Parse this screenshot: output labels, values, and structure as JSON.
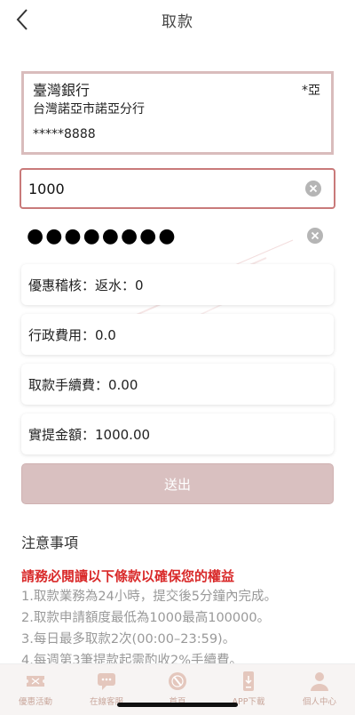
{
  "header": {
    "title": "取款"
  },
  "bank_card": {
    "bank_name": "臺灣銀行",
    "branch": "台灣諾亞市諾亞分行",
    "account_masked": "*****8888",
    "holder": "*亞"
  },
  "amount_input": {
    "value": "1000"
  },
  "password_input": {
    "value": "●●●●●●●●"
  },
  "info_rows": [
    {
      "text": "優惠稽核：返水：0"
    },
    {
      "text": "行政費用：0.0"
    },
    {
      "text": "取款手續費：0.00"
    },
    {
      "text": "實提金額：1000.00"
    }
  ],
  "submit": {
    "label": "送出"
  },
  "notes": {
    "title": "注意事項",
    "warning": "請務必閱讀以下條款以確保您的權益",
    "items": [
      "1.取款業務為24小時，提交後5分鐘內完成。",
      "2.取款申請額度最低為1000最高100000。",
      "3.每日最多取款2次(00:00–23:59)。",
      "4.每週第3筆提款起需酌收2%手續費。"
    ]
  },
  "tabbar": {
    "items": [
      {
        "label": "優惠活動",
        "icon": "ticket-icon"
      },
      {
        "label": "在線客服",
        "icon": "chat-icon"
      },
      {
        "label": "首頁",
        "icon": "home-icon"
      },
      {
        "label": "APP下載",
        "icon": "phone-download-icon"
      },
      {
        "label": "個人中心",
        "icon": "user-icon"
      }
    ],
    "accent_color": "#c9a79c"
  }
}
